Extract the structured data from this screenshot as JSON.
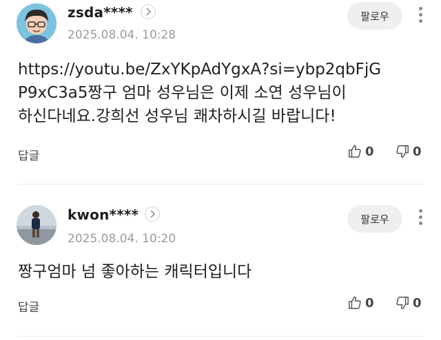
{
  "comments": [
    {
      "username": "zsda****",
      "date": "2025.08.04. 10:28",
      "follow_label": "팔로우",
      "text_lines": [
        "https://youtu.be/ZxYKpAdYgxA?si=ybp2qbFjG",
        "P9xC3a5짱구 엄마 성우님은 이제 소연 성우님이",
        "하신다네요.강희선 성우님 쾌차하시길 바랍니다!"
      ],
      "reply_label": "답글",
      "likes": "0",
      "dislikes": "0"
    },
    {
      "username": "kwon****",
      "date": "2025.08.04. 10:20",
      "follow_label": "팔로우",
      "text_lines": [
        "짱구엄마 넘 좋아하는 캐릭터입니다"
      ],
      "reply_label": "답글",
      "likes": "0",
      "dislikes": "0"
    }
  ],
  "icons": {
    "profile_link": "chevron-right-icon",
    "more": "more-vertical-icon",
    "like": "thumbs-up-icon",
    "dislike": "thumbs-down-icon"
  }
}
